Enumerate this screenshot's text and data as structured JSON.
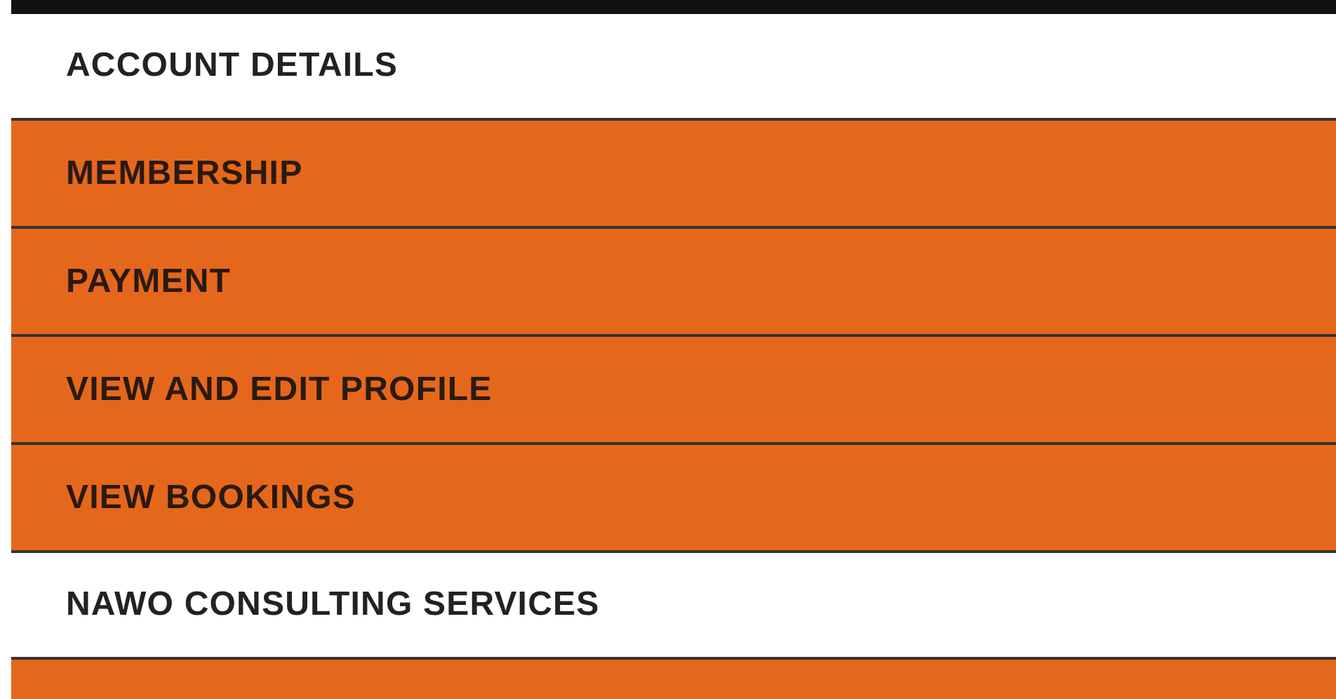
{
  "sections": [
    {
      "heading": "ACCOUNT DETAILS",
      "items": [
        {
          "label": "MEMBERSHIP"
        },
        {
          "label": "PAYMENT"
        },
        {
          "label": "VIEW AND EDIT PROFILE"
        },
        {
          "label": "VIEW BOOKINGS"
        }
      ]
    },
    {
      "heading": "NAWO CONSULTING SERVICES"
    }
  ]
}
